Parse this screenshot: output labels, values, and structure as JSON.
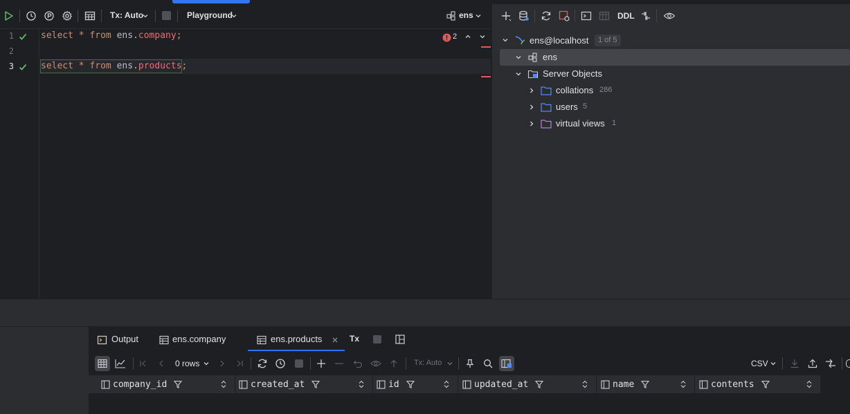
{
  "editor": {
    "toolbar": {
      "tx_label": "Tx: Auto",
      "console_label": "Playground",
      "schema_label": "ens"
    },
    "problems_count": "2",
    "lines": [
      {
        "number": "1",
        "kw1": "select",
        "star": " * ",
        "kw2": "from",
        "schema": " ens.",
        "table": "company",
        "end": ";"
      },
      {
        "number": "2"
      },
      {
        "number": "3",
        "kw1": "select",
        "star": " * ",
        "kw2": "from",
        "schema": " ens.",
        "table": "products",
        "end": ";"
      }
    ]
  },
  "db_tree": {
    "toolbar": {
      "ddl_label": "DDL"
    },
    "connection": {
      "label": "ens@localhost",
      "badge": "1 of 5"
    },
    "schema": {
      "label": "ens"
    },
    "server_objects": {
      "label": "Server Objects"
    },
    "items": [
      {
        "label": "collations",
        "count": "286",
        "color": "#548af7"
      },
      {
        "label": "users",
        "count": "5",
        "color": "#548af7"
      },
      {
        "label": "virtual views",
        "count": "1",
        "color": "#b47ee0"
      }
    ]
  },
  "results": {
    "tabs": {
      "output": "Output",
      "company": "ens.company",
      "products": "ens.products",
      "tx_short": "Tx"
    },
    "toolbar": {
      "rows_label": "0 rows",
      "tx_label": "Tx: Auto",
      "export_format": "CSV"
    },
    "columns": [
      "company_id",
      "created_at",
      "id",
      "updated_at",
      "name",
      "contents"
    ]
  },
  "colors": {
    "accent": "#3574f0",
    "success": "#5fb865",
    "error": "#db5c5c",
    "keyword": "#cf8e6d",
    "table_ref": "#fa6675"
  }
}
